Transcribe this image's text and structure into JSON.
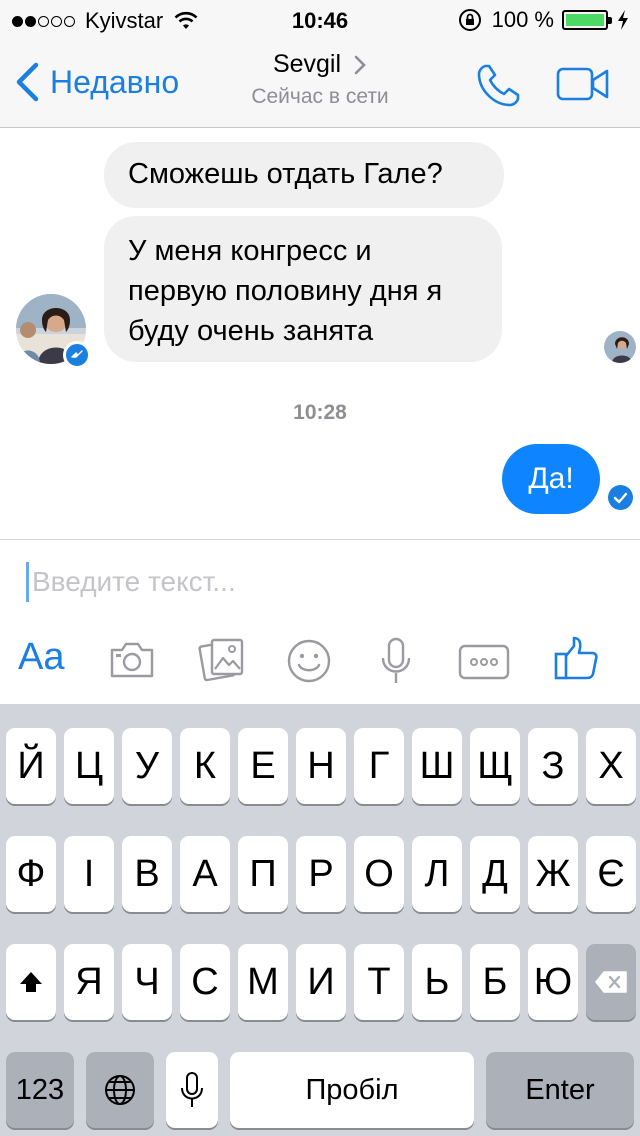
{
  "status_bar": {
    "carrier": "Kyivstar",
    "time": "10:46",
    "battery": "100 %"
  },
  "nav": {
    "back_label": "Недавно",
    "title": "Sevgil",
    "subtitle": "Сейчас в сети"
  },
  "messages": {
    "incoming": [
      {
        "text": "Сможешь отдать Гале?"
      },
      {
        "text": "У меня конгресс и первую половину дня я буду очень занята"
      }
    ],
    "timestamp": "10:28",
    "outgoing": [
      {
        "text": "Да!"
      }
    ]
  },
  "composer": {
    "placeholder": "Введите текст...",
    "font_label": "Aa",
    "icons": [
      "text-format-icon",
      "camera-icon",
      "gallery-icon",
      "emoji-icon",
      "microphone-icon",
      "more-icon",
      "thumbs-up-icon"
    ]
  },
  "keyboard": {
    "row1": [
      "Й",
      "Ц",
      "У",
      "К",
      "Е",
      "Н",
      "Г",
      "Ш",
      "Щ",
      "З",
      "Х"
    ],
    "row2": [
      "Ф",
      "І",
      "В",
      "А",
      "П",
      "Р",
      "О",
      "Л",
      "Д",
      "Ж",
      "Є"
    ],
    "row3": [
      "Я",
      "Ч",
      "С",
      "М",
      "И",
      "Т",
      "Ь",
      "Б",
      "Ю"
    ],
    "numbers_label": "123",
    "space_label": "Пробіл",
    "enter_label": "Enter"
  },
  "colors": {
    "accent": "#1a7fe0",
    "outgoing_bubble": "#0f84ff",
    "incoming_bubble": "#f0f0f0",
    "battery": "#4cd964"
  }
}
